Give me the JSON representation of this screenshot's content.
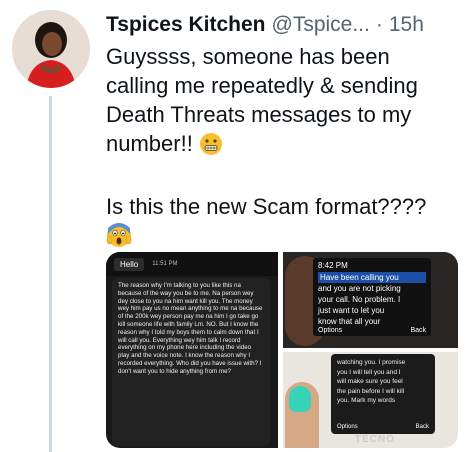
{
  "tweet": {
    "author_name": "Tspices Kitchen",
    "handle": "@Tspice...",
    "separator": "·",
    "timestamp": "15h",
    "more_icon": "···",
    "text_line1": "Guyssss, someone has been calling me repeatedly & sending Death Threats messages to my number!!",
    "text_line2": "Is this the new Scam format????",
    "emoji_grimace": "grimacing-face-emoji",
    "emoji_scream": "face-screaming-in-fear-emoji"
  },
  "media": {
    "chat": {
      "hello": "Hello",
      "hello_time": "11:51 PM",
      "message": "The reason why I'm talking to you like this na because of the way you be to me. Na person wey dey close to you na him want kill you. The money wey him pay us no mean anything to me na because of the 200k wey person pay me na him I go take go kill someone life with family Lm. NO. But I know the reason why I told my boys them to calm down that I will call you. Everything wey him talk I record everything on my phone here including the video play and the voice note. I know the reason why I recorded everything. Who did you have issue with? I don't want you to hide anything from me?"
    },
    "phone1": {
      "time": "8:42 PM",
      "lines": [
        "Have been calling you",
        "and you are not picking",
        "your call. No problem. I",
        "just want to let you",
        "know that all your"
      ],
      "options": "Options",
      "back": "Back"
    },
    "phone2": {
      "lines": [
        "watching you. I promise",
        "you I will tell you and I",
        "will make sure you feel",
        "the pain before I will kill",
        "you. Mark my words"
      ],
      "options": "Options",
      "back": "Back",
      "brand": "TECNO"
    }
  }
}
